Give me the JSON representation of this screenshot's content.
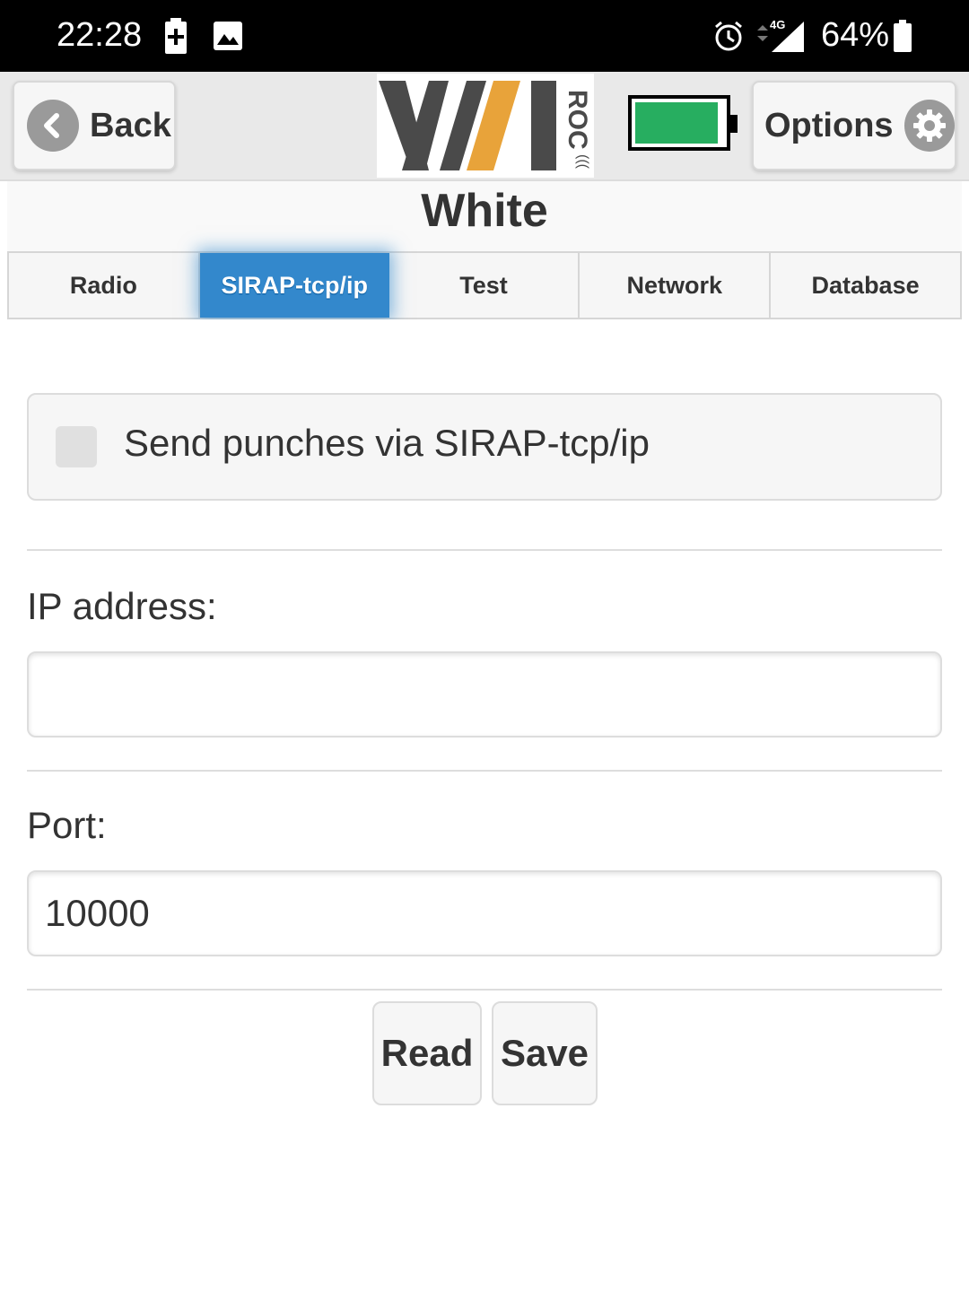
{
  "status_bar": {
    "time": "22:28",
    "battery_percent": "64%",
    "network": "4G",
    "icons": [
      "battery-saver-icon",
      "image-icon",
      "alarm-icon",
      "cell-signal-icon",
      "battery-icon"
    ]
  },
  "header": {
    "back_label": "Back",
    "options_label": "Options",
    "logo_text": "WIROC",
    "device_battery_level": 0.9,
    "colors": {
      "battery": "#27ae60",
      "logo_orange": "#e8a33a",
      "logo_gray": "#555555"
    }
  },
  "device_name": "White",
  "tabs": [
    {
      "label": "Radio",
      "active": false
    },
    {
      "label": "SIRAP-tcp/ip",
      "active": true
    },
    {
      "label": "Test",
      "active": false
    },
    {
      "label": "Network",
      "active": false
    },
    {
      "label": "Database",
      "active": false
    }
  ],
  "form": {
    "send_punches_label": "Send punches via SIRAP-tcp/ip",
    "send_punches_checked": false,
    "ip_label": "IP address:",
    "ip_value": "",
    "port_label": "Port:",
    "port_value": "10000"
  },
  "actions": {
    "read_label": "Read",
    "save_label": "Save"
  },
  "accent_color": "#3388cc"
}
